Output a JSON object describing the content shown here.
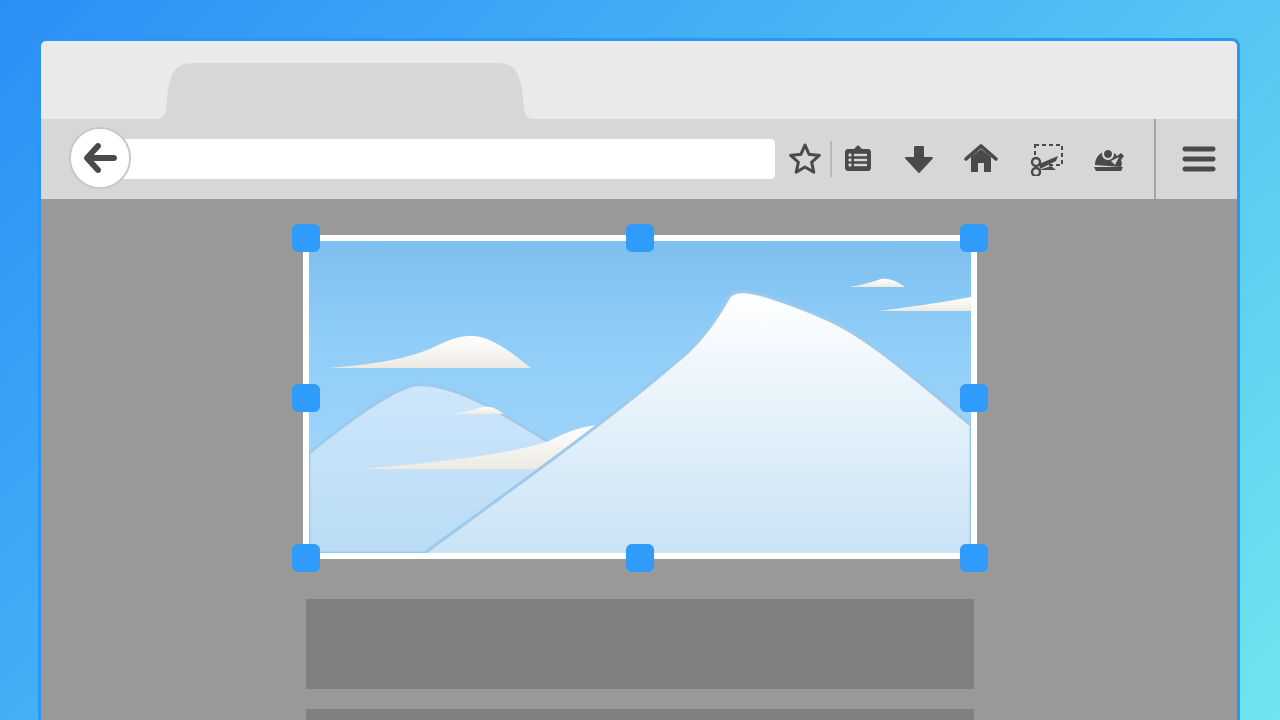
{
  "browser": {
    "tab": {
      "title": ""
    },
    "urlbar": {
      "value": ""
    },
    "toolbar": {
      "back_icon": "arrow-left-icon",
      "icons": [
        "star-icon",
        "reading-list-icon",
        "download-icon",
        "home-icon",
        "screenshot-scissors-icon",
        "extension-icon",
        "hamburger-menu-icon"
      ]
    }
  },
  "selection": {
    "handles": [
      "top-left",
      "top-center",
      "top-right",
      "middle-left",
      "middle-right",
      "bottom-left",
      "bottom-center",
      "bottom-right"
    ],
    "image_subject": "snowy-mountains-image",
    "accent_color": "#2f9cfb"
  },
  "colors": {
    "background_gradient": [
      "#2b8ff5",
      "#6fe6ee"
    ],
    "window_border": "#2a95f6",
    "content_bg": "#999999",
    "placeholder_block": "#808080"
  }
}
